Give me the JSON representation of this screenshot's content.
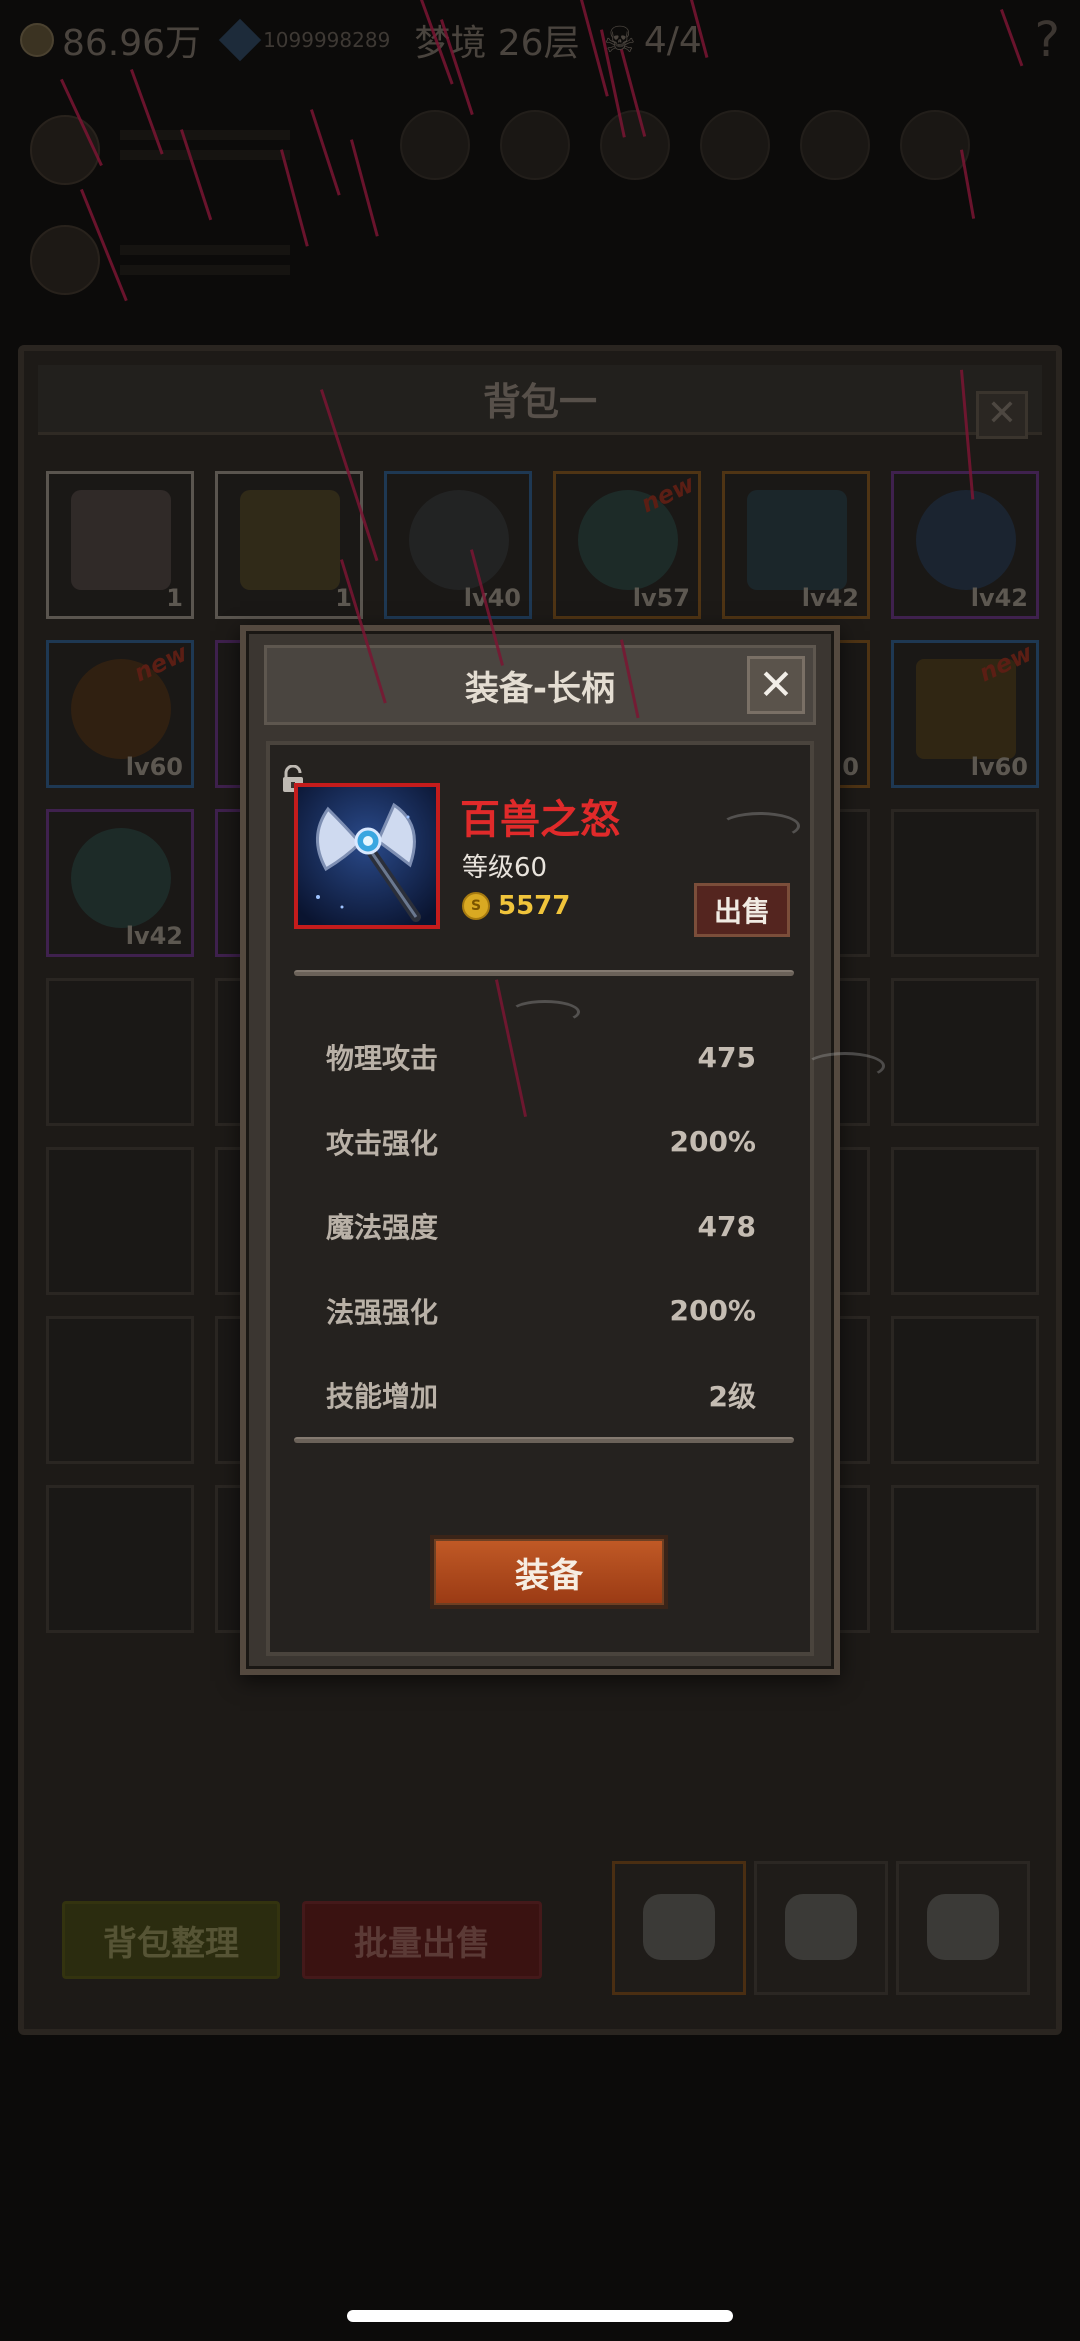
{
  "topbar": {
    "gold": "86.96万",
    "id": "1099998289",
    "realm": "梦境 26层",
    "skulls": "4/4",
    "help": "?"
  },
  "bag": {
    "title": "背包一",
    "close": "✕",
    "slots": [
      {
        "label": "1",
        "icon": "cake-icon",
        "rarity": "white",
        "new": ""
      },
      {
        "label": "1",
        "icon": "beer-mug-icon",
        "rarity": "white",
        "new": ""
      },
      {
        "label": "lv40",
        "icon": "helmet-icon",
        "rarity": "blue",
        "new": ""
      },
      {
        "label": "lv57",
        "icon": "net-orb-icon",
        "rarity": "orange",
        "new": "new"
      },
      {
        "label": "lv42",
        "icon": "staff-icon",
        "rarity": "orange",
        "new": ""
      },
      {
        "label": "lv42",
        "icon": "shield-icon",
        "rarity": "purple",
        "new": ""
      },
      {
        "label": "lv60",
        "icon": "ring-icon",
        "rarity": "blue",
        "new": "new"
      },
      {
        "label": "",
        "icon": "",
        "rarity": "purple",
        "new": ""
      },
      {
        "label": "",
        "icon": "",
        "rarity": "",
        "new": ""
      },
      {
        "label": "",
        "icon": "",
        "rarity": "",
        "new": ""
      },
      {
        "label": "0",
        "icon": "",
        "rarity": "orange",
        "new": ""
      },
      {
        "label": "lv60",
        "icon": "bow-icon",
        "rarity": "blue",
        "new": "new"
      },
      {
        "label": "lv42",
        "icon": "net-orb-icon",
        "rarity": "purple",
        "new": ""
      },
      {
        "label": "",
        "icon": "",
        "rarity": "purple",
        "new": ""
      },
      {
        "label": "",
        "icon": "",
        "rarity": "",
        "new": ""
      },
      {
        "label": "",
        "icon": "",
        "rarity": "",
        "new": ""
      },
      {
        "label": "",
        "icon": "",
        "rarity": "",
        "new": ""
      },
      {
        "label": "",
        "icon": "",
        "rarity": "",
        "new": ""
      }
    ],
    "sort_label": "背包整理",
    "bulk_sell_label": "批量出售"
  },
  "modal": {
    "title": "装备-长柄",
    "close": "✕",
    "item_name": "百兽之怒",
    "item_level": "等级60",
    "coin_symbol": "S",
    "price": "5577",
    "sell_label": "出售",
    "stats": [
      {
        "label": "物理攻击",
        "value": "475"
      },
      {
        "label": "攻击强化",
        "value": "200%"
      },
      {
        "label": "魔法强度",
        "value": "478"
      },
      {
        "label": "法强强化",
        "value": "200%"
      },
      {
        "label": "技能增加",
        "value": "2级"
      }
    ],
    "equip_label": "装备"
  },
  "colors": {
    "item_name": "#e02a2a",
    "price": "#f0c43b",
    "equip_button": "#c15a26",
    "rain_streak": "#7a1533"
  }
}
